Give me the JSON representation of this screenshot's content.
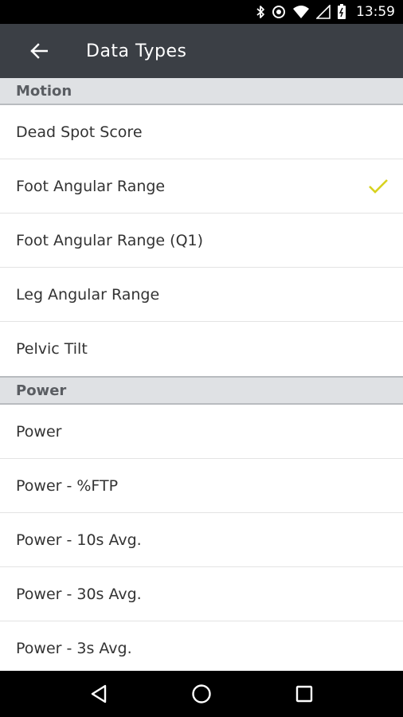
{
  "status_bar": {
    "time": "13:59",
    "icons": [
      "bluetooth-icon",
      "alarm-icon",
      "wifi-icon",
      "signal-icon",
      "battery-icon"
    ]
  },
  "app_bar": {
    "back_icon": "arrow-left-icon",
    "title": "Data Types",
    "background": "#3b3f45"
  },
  "sections": [
    {
      "header": "Motion",
      "items": [
        {
          "label": "Dead Spot Score",
          "selected": false
        },
        {
          "label": "Foot Angular Range",
          "selected": true
        },
        {
          "label": "Foot Angular Range (Q1)",
          "selected": false
        },
        {
          "label": "Leg Angular Range",
          "selected": false
        },
        {
          "label": "Pelvic Tilt",
          "selected": false
        }
      ]
    },
    {
      "header": "Power",
      "items": [
        {
          "label": "Power",
          "selected": false
        },
        {
          "label": "Power - %FTP",
          "selected": false
        },
        {
          "label": "Power - 10s Avg.",
          "selected": false
        },
        {
          "label": "Power - 30s Avg.",
          "selected": false
        },
        {
          "label": "Power - 3s Avg.",
          "selected": false
        }
      ]
    }
  ],
  "check_color": "#d8d21f",
  "nav_bar": {
    "buttons": [
      "back-triangle-icon",
      "home-circle-icon",
      "recents-square-icon"
    ]
  }
}
